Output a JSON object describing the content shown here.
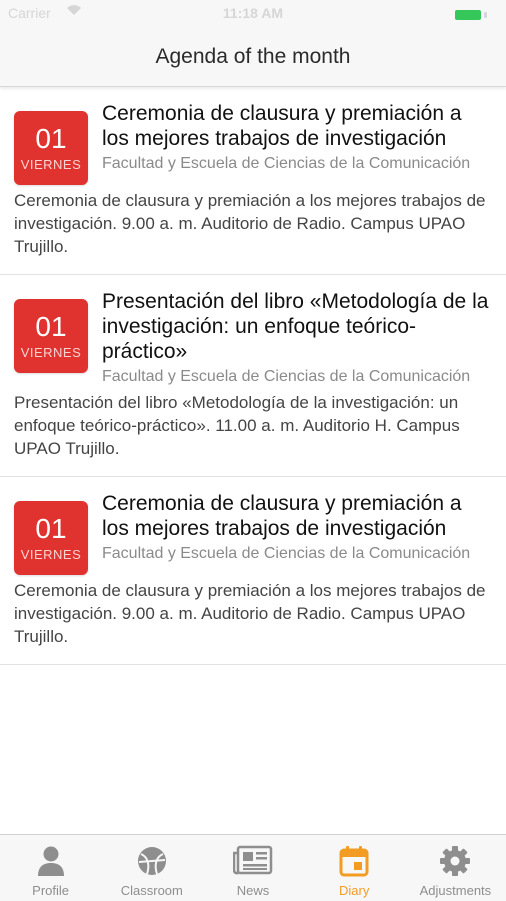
{
  "status_bar": {
    "carrier": "Carrier",
    "time": "11:18 AM"
  },
  "header": {
    "title": "Agenda of the month"
  },
  "events": [
    {
      "day": "01",
      "weekday": "VIERNES",
      "title": "Ceremonia de clausura y premiación a los mejores trabajos de investigación",
      "organizer": "Facultad y Escuela de Ciencias de la Comunicación",
      "description": "Ceremonia de clausura y premiación a los mejores trabajos de investigación. 9.00 a. m. Auditorio de Radio. Campus UPAO Trujillo."
    },
    {
      "day": "01",
      "weekday": "VIERNES",
      "title": "Presentación del libro «Metodología de la investigación: un enfoque teórico-práctico»",
      "organizer": "Facultad y Escuela de Ciencias de la Comunicación",
      "description": "Presentación del libro «Metodología de la investigación: un enfoque teórico-práctico». 11.00 a. m. Auditorio H. Campus UPAO Trujillo."
    },
    {
      "day": "01",
      "weekday": "VIERNES",
      "title": "Ceremonia de clausura y premiación a los mejores trabajos de investigación",
      "organizer": "Facultad y Escuela de Ciencias de la Comunicación",
      "description": "Ceremonia de clausura y premiación a los mejores trabajos de investigación. 9.00 a. m. Auditorio de Radio. Campus UPAO Trujillo."
    }
  ],
  "tab_bar": {
    "tabs": [
      {
        "label": "Profile",
        "icon": "person-icon"
      },
      {
        "label": "Classroom",
        "icon": "ball-icon"
      },
      {
        "label": "News",
        "icon": "newspaper-icon"
      },
      {
        "label": "Diary",
        "icon": "calendar-icon",
        "active": true
      },
      {
        "label": "Adjustments",
        "icon": "gear-icon"
      }
    ]
  },
  "colors": {
    "badge": "#e0322f",
    "active_tab": "#f39c23",
    "inactive_tab": "#8e8e8e",
    "battery": "#35c759"
  }
}
